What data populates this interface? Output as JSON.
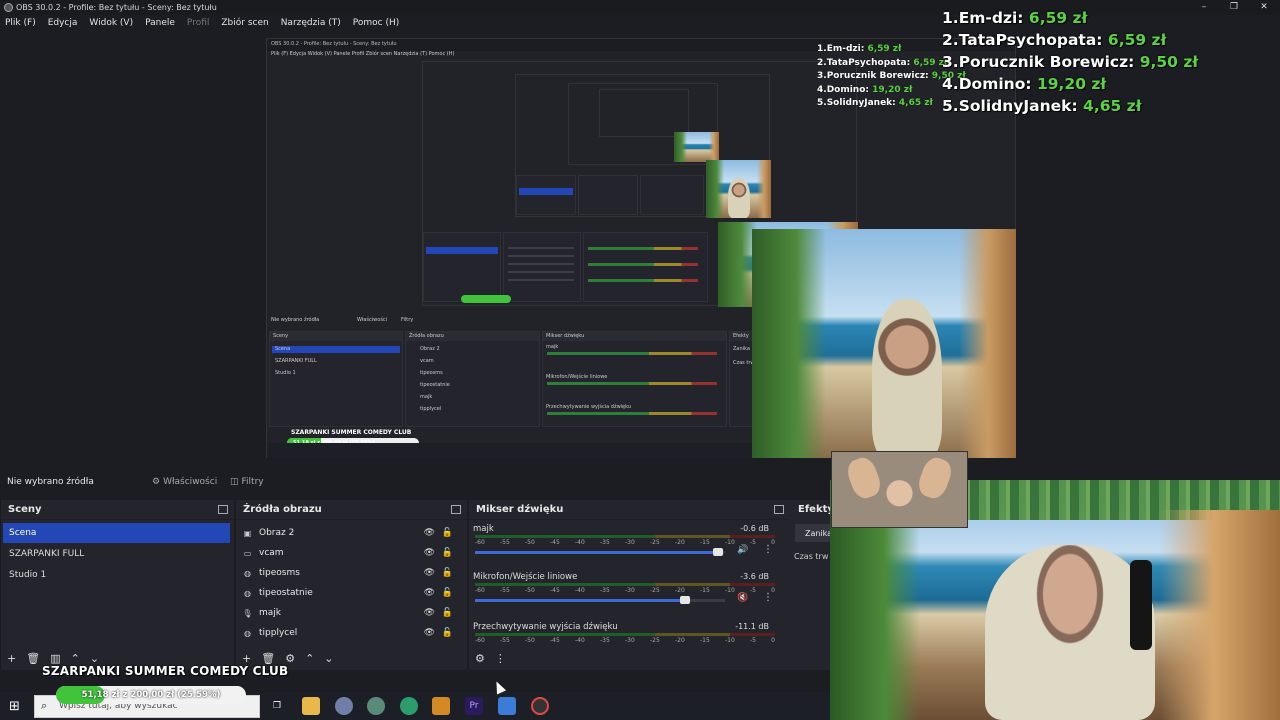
{
  "window": {
    "title": "OBS 30.0.2 - Profile: Bez tytułu - Sceny: Bez tytułu",
    "minimize": "–",
    "maximize": "❐",
    "close": "✕"
  },
  "menu": [
    "Plik (F)",
    "Edycja",
    "Widok (V)",
    "Panele",
    "Profil",
    "Zbiór scen",
    "Narzędzia (T)",
    "Pomoc (H)"
  ],
  "status": {
    "no_source": "Nie wybrano źródła",
    "properties": "Właściwości",
    "filters": "Filtry"
  },
  "scenes": {
    "title": "Sceny",
    "items": [
      "Scena",
      "SZARPANKI FULL",
      "Studio 1"
    ],
    "active_index": 0
  },
  "sources": {
    "title": "Źródła obrazu",
    "items": [
      {
        "name": "Obraz 2",
        "icon": "image-icon"
      },
      {
        "name": "vcam",
        "icon": "camera-icon"
      },
      {
        "name": "tipeosms",
        "icon": "browser-icon"
      },
      {
        "name": "tipeostatnie",
        "icon": "browser-icon"
      },
      {
        "name": "majk",
        "icon": "microphone-icon"
      },
      {
        "name": "tipplycel",
        "icon": "browser-icon"
      }
    ]
  },
  "mixer": {
    "title": "Mikser dźwięku",
    "ticks": [
      "-60",
      "-55",
      "-50",
      "-45",
      "-40",
      "-35",
      "-30",
      "-25",
      "-20",
      "-15",
      "-10",
      "-5",
      "0"
    ],
    "tracks": [
      {
        "name": "majk",
        "db": "-0.6 dB",
        "fader": 0.97
      },
      {
        "name": "Mikrofon/Wejście liniowe",
        "db": "-3.6 dB",
        "fader": 0.84
      },
      {
        "name": "Przechwytywanie wyjścia dźwięku",
        "db": "-11.1 dB"
      }
    ]
  },
  "effects": {
    "title": "Efekty",
    "button": "Zanika",
    "label": "Czas trw"
  },
  "leaderboard": [
    {
      "rank": "1.",
      "name": "Em-dzi:",
      "amount": "6,59 zł"
    },
    {
      "rank": "2.",
      "name": "TataPsychopata:",
      "amount": "6,59 zł"
    },
    {
      "rank": "3.",
      "name": "Porucznik Borewicz:",
      "amount": "9,50 zł"
    },
    {
      "rank": "4.",
      "name": "Domino:",
      "amount": "19,20 zł"
    },
    {
      "rank": "5.",
      "name": "SolidnyJanek:",
      "amount": "4,65 zł"
    }
  ],
  "goal": {
    "title": "SZARPANKI SUMMER COMEDY CLUB",
    "text": "51,18 zł z 200,00 zł (25.59%)",
    "progress": 0.2559
  },
  "taskbar": {
    "search_placeholder": "Wpisz tutaj, aby wyszukać",
    "apps": [
      "task-view",
      "file-explorer",
      "app-1",
      "app-2",
      "edge",
      "app-3",
      "premiere",
      "app-4",
      "obs"
    ]
  },
  "nested_preview": {
    "title": "OBS 30.0.2 - Profile: Bez tytułu - Sceny: Bez tytułu",
    "menu": "Plik (F)   Edycja   Widok (V)   Panele   Profil   Zbiór scen   Narzędzia (T)   Pomoc (H)",
    "status": "Nie wybrano źródła",
    "props": "Właściwości",
    "filters": "Filtry",
    "scenes_title": "Sceny",
    "sources_title": "Źródła obrazu",
    "mixer_title": "Mikser dźwięku",
    "effects_title": "Efekty",
    "scene_items": [
      "Scena",
      "SZARPANKI FULL",
      "Studio 1"
    ],
    "source_items": [
      "Obraz 2",
      "vcam",
      "tipeosms",
      "tipeostatnie",
      "majk",
      "tipplycel"
    ],
    "tracks": [
      "majk",
      "Mikrofon/Wejście liniowe",
      "Przechwytywanie wyjścia dźwięku"
    ],
    "effects_button": "Zanika",
    "effects_label": "Czas trw",
    "club": "SZARPANKI SUMMER COMEDY CLUB",
    "goal": "51,18 zł z 200,00 zł (25.59%)"
  },
  "colors": {
    "accent": "#2447b8",
    "panel": "#24252c",
    "amount": "#5bd23f",
    "goal_fill": "#41c43b"
  }
}
